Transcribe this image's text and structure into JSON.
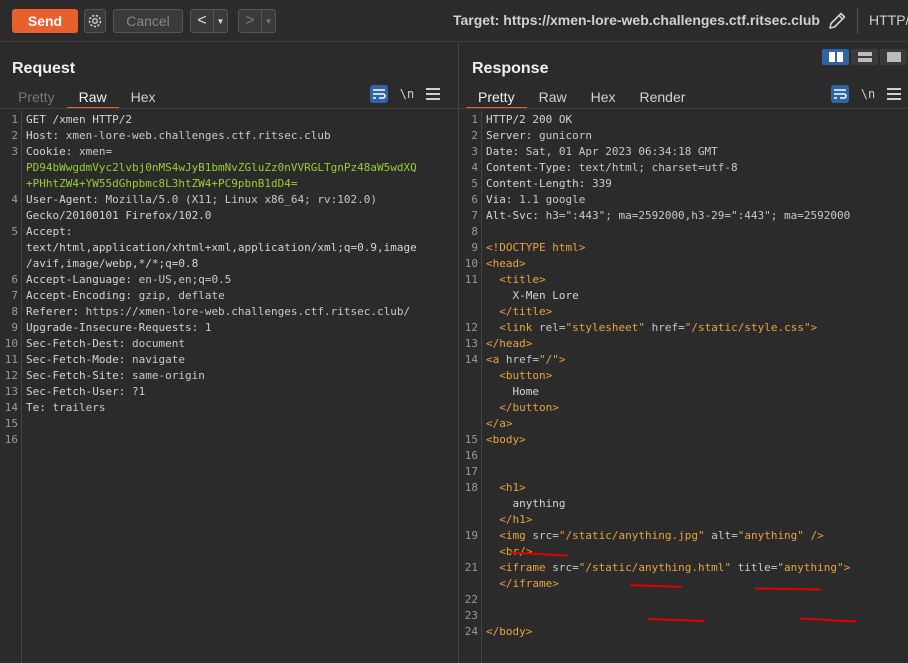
{
  "toolbar": {
    "send_label": "Send",
    "cancel_label": "Cancel",
    "back_glyph": "<",
    "forward_glyph": ">",
    "target_label": "Target: https://xmen-lore-web.challenges.ctf.ritsec.club",
    "protocol_label": "HTTP/"
  },
  "request": {
    "title": "Request",
    "tabs": [
      "Pretty",
      "Raw",
      "Hex"
    ],
    "active_tab": "Raw",
    "lines": [
      {
        "n": "1",
        "text": "GET /xmen HTTP/2"
      },
      {
        "n": "2",
        "k": "Host",
        "v": "xmen-lore-web.challenges.ctf.ritsec.club"
      },
      {
        "n": "3",
        "k": "Cookie",
        "v": "xmen="
      },
      {
        "n": "",
        "cookie": "PD94bWwgdmVyc2lvbj0nMS4wJyB1bmNvZGluZz0nVVRGLTgnPz48aW5wdXQ"
      },
      {
        "n": "",
        "cookie": "+PHhtZW4+YW55dGhpbmc8L3htZW4+PC9pbnB1dD4="
      },
      {
        "n": "4",
        "k": "User-Agent",
        "v": "Mozilla/5.0 (X11; Linux x86_64; rv:102.0)"
      },
      {
        "n": "",
        "text": "Gecko/20100101 Firefox/102.0"
      },
      {
        "n": "5",
        "k": "Accept",
        "v": ""
      },
      {
        "n": "",
        "text": "text/html,application/xhtml+xml,application/xml;q=0.9,image"
      },
      {
        "n": "",
        "text": "/avif,image/webp,*/*;q=0.8"
      },
      {
        "n": "6",
        "k": "Accept-Language",
        "v": "en-US,en;q=0.5"
      },
      {
        "n": "7",
        "k": "Accept-Encoding",
        "v": "gzip, deflate"
      },
      {
        "n": "8",
        "k": "Referer",
        "v": "https://xmen-lore-web.challenges.ctf.ritsec.club/"
      },
      {
        "n": "9",
        "k": "Upgrade-Insecure-Requests",
        "v": "1"
      },
      {
        "n": "10",
        "k": "Sec-Fetch-Dest",
        "v": "document"
      },
      {
        "n": "11",
        "k": "Sec-Fetch-Mode",
        "v": "navigate"
      },
      {
        "n": "12",
        "k": "Sec-Fetch-Site",
        "v": "same-origin"
      },
      {
        "n": "13",
        "k": "Sec-Fetch-User",
        "v": "?1"
      },
      {
        "n": "14",
        "k": "Te",
        "v": "trailers"
      },
      {
        "n": "15",
        "text": ""
      },
      {
        "n": "16",
        "text": ""
      }
    ]
  },
  "response": {
    "title": "Response",
    "tabs": [
      "Pretty",
      "Raw",
      "Hex",
      "Render"
    ],
    "active_tab": "Pretty",
    "lines": [
      {
        "n": "1",
        "text": "HTTP/2 200 OK"
      },
      {
        "n": "2",
        "k": "Server",
        "v": "gunicorn"
      },
      {
        "n": "3",
        "k": "Date",
        "v": "Sat, 01 Apr 2023 06:34:18 GMT"
      },
      {
        "n": "4",
        "k": "Content-Type",
        "v": "text/html; charset=utf-8"
      },
      {
        "n": "5",
        "k": "Content-Length",
        "v": "339"
      },
      {
        "n": "6",
        "k": "Via",
        "v": "1.1 google"
      },
      {
        "n": "7",
        "k": "Alt-Svc",
        "v": "h3=\":443\"; ma=2592000,h3-29=\":443\"; ma=2592000"
      },
      {
        "n": "8",
        "text": ""
      },
      {
        "n": "9",
        "html": [
          [
            "t",
            "<!DOCTYPE html>"
          ]
        ]
      },
      {
        "n": "10",
        "html": [
          [
            "t",
            "<head>"
          ]
        ]
      },
      {
        "n": "11",
        "html": [
          [
            "p",
            "  "
          ],
          [
            "t",
            "<title>"
          ]
        ]
      },
      {
        "n": "",
        "html": [
          [
            "p",
            "    X-Men Lore"
          ]
        ]
      },
      {
        "n": "",
        "html": [
          [
            "p",
            "  "
          ],
          [
            "t",
            "</title>"
          ]
        ]
      },
      {
        "n": "12",
        "html": [
          [
            "p",
            "  "
          ],
          [
            "t",
            "<link "
          ],
          [
            "a",
            "rel="
          ],
          [
            "v",
            "\"stylesheet\""
          ],
          [
            "a",
            " href="
          ],
          [
            "v",
            "\"/static/style.css\""
          ],
          [
            "t",
            ">"
          ]
        ]
      },
      {
        "n": "13",
        "html": [
          [
            "t",
            "</head>"
          ]
        ]
      },
      {
        "n": "14",
        "html": [
          [
            "t",
            "<a "
          ],
          [
            "a",
            "href="
          ],
          [
            "v",
            "\"/\""
          ],
          [
            "t",
            ">"
          ]
        ]
      },
      {
        "n": "",
        "html": [
          [
            "p",
            "  "
          ],
          [
            "t",
            "<button>"
          ]
        ]
      },
      {
        "n": "",
        "html": [
          [
            "p",
            "    Home"
          ]
        ]
      },
      {
        "n": "",
        "html": [
          [
            "p",
            "  "
          ],
          [
            "t",
            "</button>"
          ]
        ]
      },
      {
        "n": "",
        "html": [
          [
            "t",
            "</a>"
          ]
        ]
      },
      {
        "n": "15",
        "html": [
          [
            "t",
            "<body>"
          ]
        ]
      },
      {
        "n": "16",
        "text": ""
      },
      {
        "n": "17",
        "text": ""
      },
      {
        "n": "18",
        "html": [
          [
            "p",
            "  "
          ],
          [
            "t",
            "<h1>"
          ]
        ]
      },
      {
        "n": "",
        "html": [
          [
            "p",
            "    anything"
          ]
        ]
      },
      {
        "n": "",
        "html": [
          [
            "p",
            "  "
          ],
          [
            "t",
            "</h1>"
          ]
        ]
      },
      {
        "n": "19",
        "html": [
          [
            "p",
            "  "
          ],
          [
            "t",
            "<img "
          ],
          [
            "a",
            "src="
          ],
          [
            "v",
            "\"/static/anything.jpg\""
          ],
          [
            "a",
            " alt="
          ],
          [
            "v",
            "\"anything\""
          ],
          [
            "p",
            " "
          ],
          [
            "t",
            "/>"
          ]
        ]
      },
      {
        "n": "",
        "html": [
          [
            "p",
            "  "
          ],
          [
            "t",
            "<br/>"
          ]
        ]
      },
      {
        "n": "21",
        "html": [
          [
            "p",
            "  "
          ],
          [
            "t",
            "<iframe "
          ],
          [
            "a",
            "src="
          ],
          [
            "v",
            "\"/static/anything.html\""
          ],
          [
            "a",
            " title="
          ],
          [
            "v",
            "\"anything\""
          ],
          [
            "t",
            ">"
          ]
        ]
      },
      {
        "n": "",
        "html": [
          [
            "p",
            "  "
          ],
          [
            "t",
            "</iframe>"
          ]
        ]
      },
      {
        "n": "22",
        "text": ""
      },
      {
        "n": "23",
        "text": ""
      },
      {
        "n": "24",
        "html": [
          [
            "t",
            "</body>"
          ]
        ]
      }
    ]
  }
}
